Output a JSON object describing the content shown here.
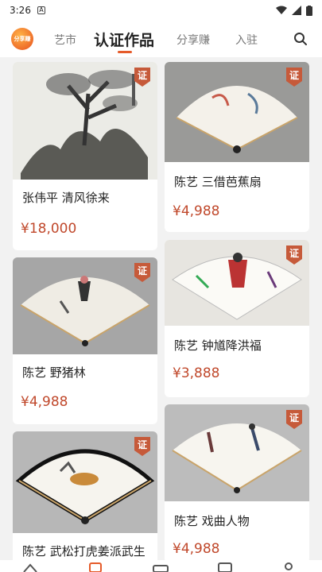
{
  "status": {
    "time": "3:26"
  },
  "nav": {
    "tabs": [
      {
        "label": "艺市"
      },
      {
        "label": "认证作品"
      },
      {
        "label": "分享赚"
      },
      {
        "label": "入驻"
      }
    ],
    "logo_text": "分享赚"
  },
  "cert_badge": "证",
  "products": [
    {
      "title": "张伟平 清风徐来",
      "price": "¥18,000"
    },
    {
      "title": "陈艺 三借芭蕉扇",
      "price": "¥4,988"
    },
    {
      "title": "陈艺 野猪林",
      "price": "¥4,988"
    },
    {
      "title": "陈艺 钟馗降洪福",
      "price": "¥3,888"
    },
    {
      "title": "陈艺 武松打虎姜派武生",
      "price": ""
    },
    {
      "title": "陈艺 戏曲人物",
      "price": "¥4,988"
    }
  ]
}
